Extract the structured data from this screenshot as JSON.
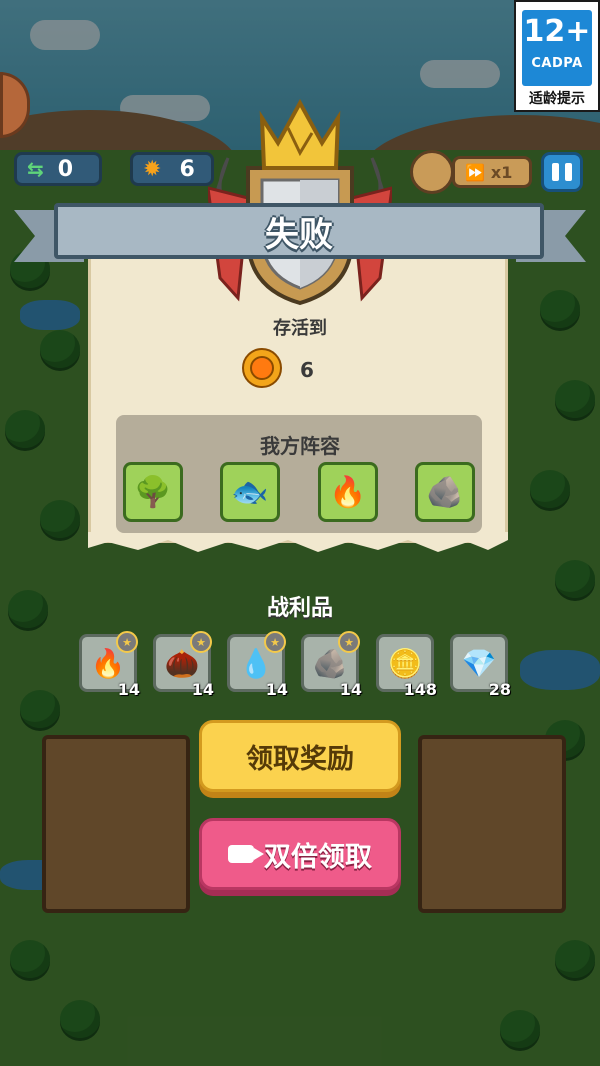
{
  "hud": {
    "swaps_count": "0",
    "sun_count": "6",
    "speed_label": "x1"
  },
  "age_rating": {
    "number": "12+",
    "org": "CADPA",
    "label": "适龄提示"
  },
  "result": {
    "title": "失败",
    "survived_label": "存活到",
    "survived_value": "6",
    "team_label": "我方阵容"
  },
  "team": [
    {
      "icon": "tree-monster-icon",
      "glyph": "🌳"
    },
    {
      "icon": "blue-slime-icon",
      "glyph": "🐟"
    },
    {
      "icon": "fire-golem-icon",
      "glyph": "🔥"
    },
    {
      "icon": "rock-golem-icon",
      "glyph": "🪨"
    }
  ],
  "loot": {
    "title": "战利品",
    "items": [
      {
        "icon": "fire-spirit-icon",
        "glyph": "🔥",
        "count": "14",
        "star": true
      },
      {
        "icon": "seed-sprout-icon",
        "glyph": "🌰",
        "count": "14",
        "star": true
      },
      {
        "icon": "water-slime-icon",
        "glyph": "💧",
        "count": "14",
        "star": true
      },
      {
        "icon": "rock-piece-icon",
        "glyph": "🪨",
        "count": "14",
        "star": true
      },
      {
        "icon": "gold-coin-icon",
        "glyph": "🪙",
        "count": "148",
        "star": false
      },
      {
        "icon": "purple-gem-icon",
        "glyph": "💎",
        "count": "28",
        "star": false
      }
    ]
  },
  "buttons": {
    "claim": "领取奖励",
    "double_claim": "双倍领取"
  },
  "colors": {
    "claim_button": "#fbd24e",
    "double_button": "#ef5b8a",
    "banner": "#a8b8c4",
    "panel": "#f1e8cf"
  }
}
